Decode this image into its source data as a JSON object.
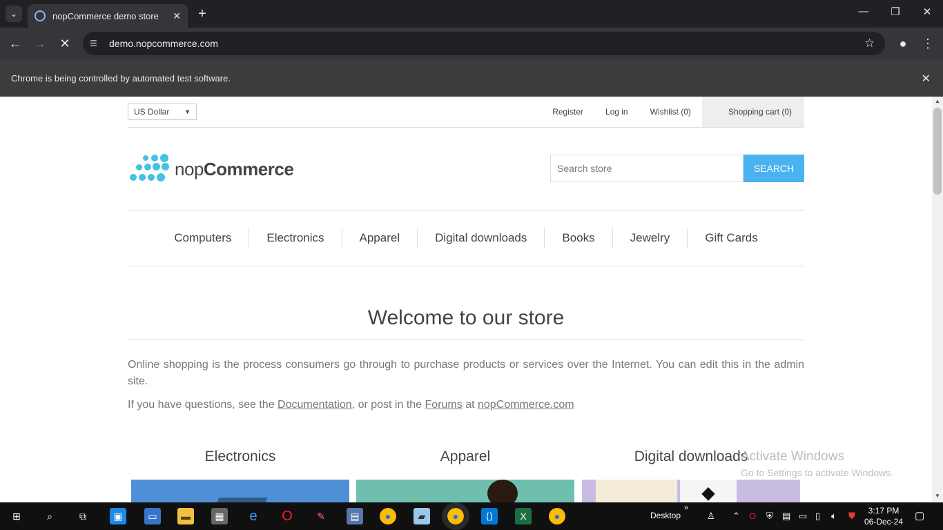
{
  "browser": {
    "tab_title": "nopCommerce demo store",
    "url": "demo.nopcommerce.com",
    "automation_notice": "Chrome is being controlled by automated test software."
  },
  "header": {
    "currency": "US Dollar",
    "links": [
      "Register",
      "Log in",
      "Wishlist (0)"
    ],
    "cart": "Shopping cart (0)"
  },
  "logo": {
    "part1": "nop",
    "part2": "Commerce",
    "dot_color": "#44c1e3"
  },
  "search": {
    "placeholder": "Search store",
    "button": "SEARCH",
    "button_color": "#4ab2f1"
  },
  "menu": [
    "Computers",
    "Electronics",
    "Apparel",
    "Digital downloads",
    "Books",
    "Jewelry",
    "Gift Cards"
  ],
  "main": {
    "welcome": "Welcome to our store",
    "paragraph1": "Online shopping is the process consumers go through to purchase products or services over the Internet. You can edit this in the admin site.",
    "paragraph2_prefix": "If you have questions, see the",
    "link_documentation": "Documentation",
    "paragraph2_mid": ", or post in the",
    "link_forums": "Forums",
    "paragraph2_at": "at",
    "link_site": "nopCommerce.com"
  },
  "categories": [
    "Electronics",
    "Apparel",
    "Digital downloads"
  ],
  "watermark": {
    "line1": "Activate Windows",
    "line2": "Go to Settings to activate Windows."
  },
  "taskbar": {
    "desktop_label": "Desktop",
    "time": "3:17 PM",
    "date": "06-Dec-24"
  }
}
